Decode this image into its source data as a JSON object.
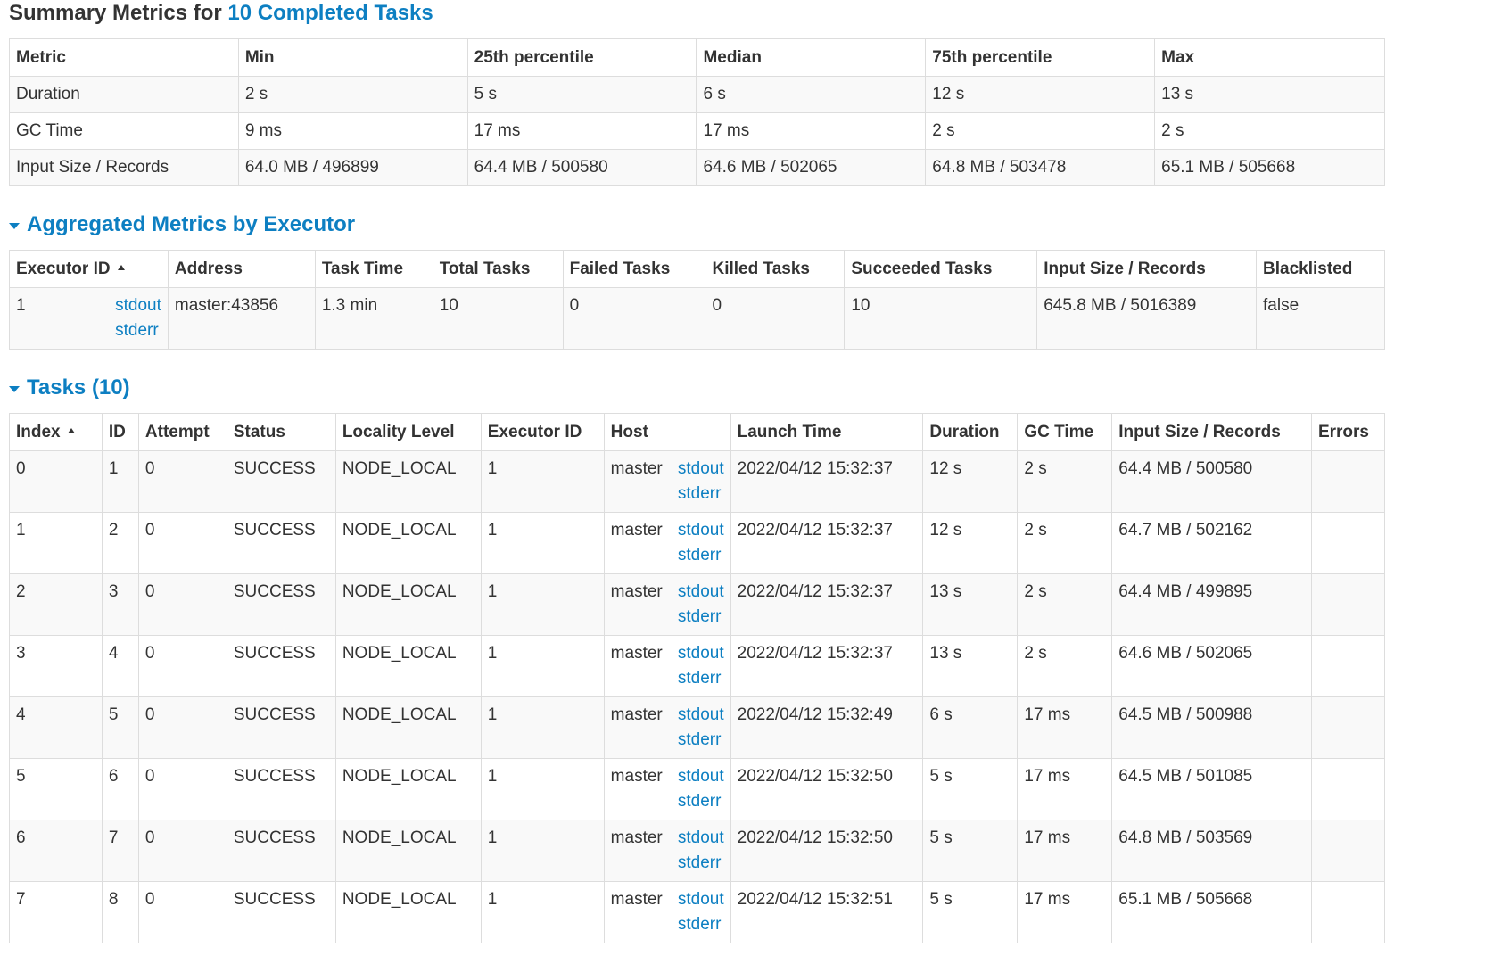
{
  "summary": {
    "title_prefix": "Summary Metrics for ",
    "title_link": "10 Completed Tasks",
    "headers": [
      "Metric",
      "Min",
      "25th percentile",
      "Median",
      "75th percentile",
      "Max"
    ],
    "rows": [
      [
        "Duration",
        "2 s",
        "5 s",
        "6 s",
        "12 s",
        "13 s"
      ],
      [
        "GC Time",
        "9 ms",
        "17 ms",
        "17 ms",
        "2 s",
        "2 s"
      ],
      [
        "Input Size / Records",
        "64.0 MB / 496899",
        "64.4 MB / 500580",
        "64.6 MB / 502065",
        "64.8 MB / 503478",
        "65.1 MB / 505668"
      ]
    ]
  },
  "aggregated": {
    "title": "Aggregated Metrics by Executor",
    "headers": [
      "Executor ID",
      "Address",
      "Task Time",
      "Total Tasks",
      "Failed Tasks",
      "Killed Tasks",
      "Succeeded Tasks",
      "Input Size / Records",
      "Blacklisted"
    ],
    "row": {
      "executor_id": "1",
      "stdout": "stdout",
      "stderr": "stderr",
      "address": "master:43856",
      "task_time": "1.3 min",
      "total_tasks": "10",
      "failed_tasks": "0",
      "killed_tasks": "0",
      "succeeded_tasks": "10",
      "input": "645.8 MB / 5016389",
      "blacklisted": "false"
    }
  },
  "tasks": {
    "title": "Tasks (10)",
    "headers": [
      "Index",
      "ID",
      "Attempt",
      "Status",
      "Locality Level",
      "Executor ID",
      "Host",
      "Launch Time",
      "Duration",
      "GC Time",
      "Input Size / Records",
      "Errors"
    ],
    "stdout": "stdout",
    "stderr": "stderr",
    "rows": [
      {
        "index": "0",
        "id": "1",
        "attempt": "0",
        "status": "SUCCESS",
        "locality": "NODE_LOCAL",
        "executor": "1",
        "host": "master",
        "launch": "2022/04/12 15:32:37",
        "duration": "12 s",
        "gc": "2 s",
        "input": "64.4 MB / 500580",
        "errors": ""
      },
      {
        "index": "1",
        "id": "2",
        "attempt": "0",
        "status": "SUCCESS",
        "locality": "NODE_LOCAL",
        "executor": "1",
        "host": "master",
        "launch": "2022/04/12 15:32:37",
        "duration": "12 s",
        "gc": "2 s",
        "input": "64.7 MB / 502162",
        "errors": ""
      },
      {
        "index": "2",
        "id": "3",
        "attempt": "0",
        "status": "SUCCESS",
        "locality": "NODE_LOCAL",
        "executor": "1",
        "host": "master",
        "launch": "2022/04/12 15:32:37",
        "duration": "13 s",
        "gc": "2 s",
        "input": "64.4 MB / 499895",
        "errors": ""
      },
      {
        "index": "3",
        "id": "4",
        "attempt": "0",
        "status": "SUCCESS",
        "locality": "NODE_LOCAL",
        "executor": "1",
        "host": "master",
        "launch": "2022/04/12 15:32:37",
        "duration": "13 s",
        "gc": "2 s",
        "input": "64.6 MB / 502065",
        "errors": ""
      },
      {
        "index": "4",
        "id": "5",
        "attempt": "0",
        "status": "SUCCESS",
        "locality": "NODE_LOCAL",
        "executor": "1",
        "host": "master",
        "launch": "2022/04/12 15:32:49",
        "duration": "6 s",
        "gc": "17 ms",
        "input": "64.5 MB / 500988",
        "errors": ""
      },
      {
        "index": "5",
        "id": "6",
        "attempt": "0",
        "status": "SUCCESS",
        "locality": "NODE_LOCAL",
        "executor": "1",
        "host": "master",
        "launch": "2022/04/12 15:32:50",
        "duration": "5 s",
        "gc": "17 ms",
        "input": "64.5 MB / 501085",
        "errors": ""
      },
      {
        "index": "6",
        "id": "7",
        "attempt": "0",
        "status": "SUCCESS",
        "locality": "NODE_LOCAL",
        "executor": "1",
        "host": "master",
        "launch": "2022/04/12 15:32:50",
        "duration": "5 s",
        "gc": "17 ms",
        "input": "64.8 MB / 503569",
        "errors": ""
      },
      {
        "index": "7",
        "id": "8",
        "attempt": "0",
        "status": "SUCCESS",
        "locality": "NODE_LOCAL",
        "executor": "1",
        "host": "master",
        "launch": "2022/04/12 15:32:51",
        "duration": "5 s",
        "gc": "17 ms",
        "input": "65.1 MB / 505668",
        "errors": ""
      }
    ]
  },
  "colors": {
    "link": "#0d7fc2",
    "text": "#333333",
    "border": "#dddddd",
    "stripe": "#f9f9f9"
  }
}
